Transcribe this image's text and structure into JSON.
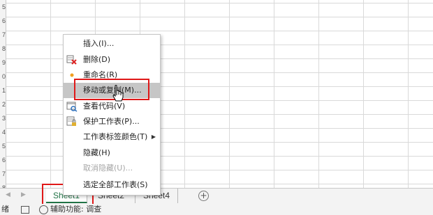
{
  "rows": [
    "5",
    "6",
    "7",
    "8",
    "9",
    "0",
    "1",
    "2",
    "3",
    "4",
    "5",
    "6",
    "7",
    "8"
  ],
  "context_menu": {
    "items": [
      {
        "label": "插入(I)...",
        "icon": "",
        "disabled": false
      },
      {
        "label": "删除(D)",
        "icon": "delete-sheet-icon",
        "disabled": false
      },
      {
        "label": "重命名(R)",
        "icon": "rename-dot-icon",
        "disabled": false
      },
      {
        "label": "移动或复制(M)...",
        "icon": "",
        "disabled": false
      },
      {
        "label": "查看代码(V)",
        "icon": "view-code-icon",
        "disabled": false
      },
      {
        "label": "保护工作表(P)...",
        "icon": "protect-sheet-icon",
        "disabled": false
      },
      {
        "label": "工作表标签颜色(T)",
        "icon": "",
        "disabled": false
      },
      {
        "label": "隐藏(H)",
        "icon": "",
        "disabled": false
      },
      {
        "label": "取消隐藏(U)...",
        "icon": "",
        "disabled": true
      },
      {
        "label": "选定全部工作表(S)",
        "icon": "",
        "disabled": false
      }
    ]
  },
  "sheet_tabs": [
    "Sheet1",
    "Sheet2",
    "Sheet4"
  ],
  "sheet_nav": {
    "prev": "◀",
    "next": "▶"
  },
  "add_sheet": "+",
  "status": {
    "ready": "绪",
    "accessibility": "辅助功能: 调查"
  },
  "colors": {
    "accent": "#217346",
    "highlight": "#e01818"
  }
}
